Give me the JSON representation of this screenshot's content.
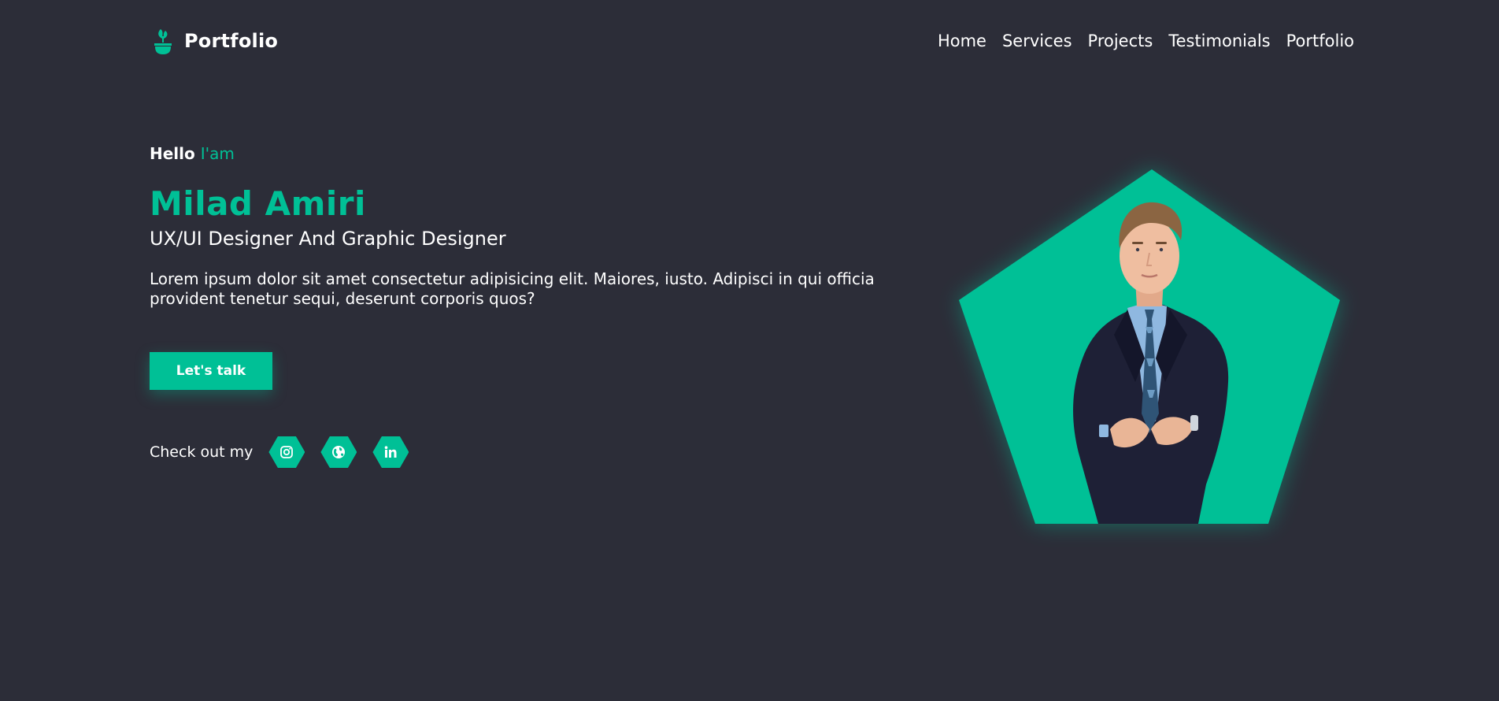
{
  "brand": {
    "name": "Portfolio",
    "icon": "plant-pot-icon"
  },
  "nav": {
    "items": [
      {
        "label": "Home"
      },
      {
        "label": "Services"
      },
      {
        "label": "Projects"
      },
      {
        "label": "Testimonials"
      },
      {
        "label": "Portfolio"
      }
    ]
  },
  "hero": {
    "greeting": "Hello",
    "greeting_accent": "I'am",
    "name": "Milad Amiri",
    "role": "UX/UI Designer And Graphic Designer",
    "description": "Lorem ipsum dolor sit amet consectetur adipisicing elit. Maiores, iusto. Adipisci in qui officia provident tenetur sequi, deserunt corporis quos?",
    "cta_label": "Let's talk"
  },
  "social": {
    "label": "Check out my",
    "links": [
      {
        "icon": "instagram-icon"
      },
      {
        "icon": "globe-icon"
      },
      {
        "icon": "linkedin-icon"
      }
    ]
  },
  "colors": {
    "background": "#2c2d38",
    "accent": "#00c096",
    "text": "#ffffff"
  }
}
